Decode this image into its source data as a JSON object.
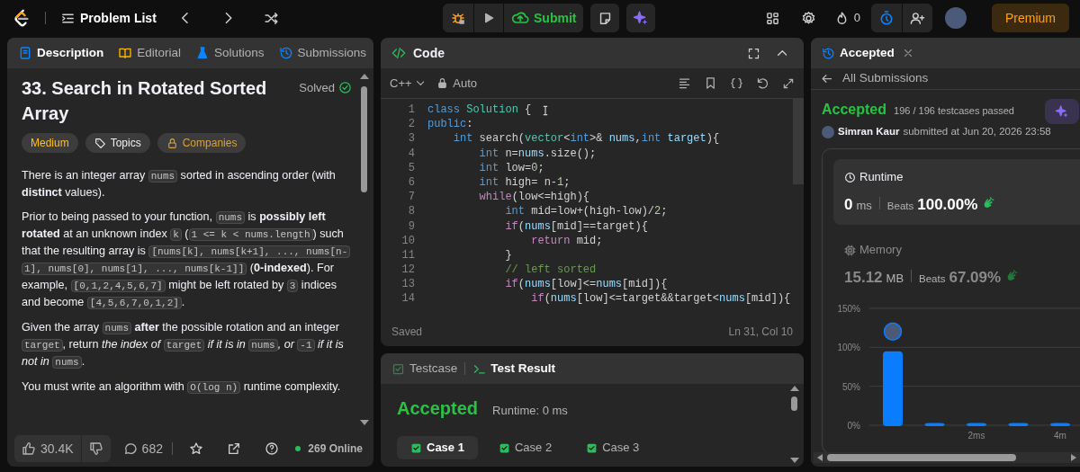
{
  "topbar": {
    "problem_list": "Problem List",
    "submit": "Submit",
    "streak": "0",
    "premium": "Premium"
  },
  "description_panel": {
    "tabs": [
      {
        "label": "Description",
        "kind": "description",
        "selected": true
      },
      {
        "label": "Editorial",
        "kind": "editorial",
        "selected": false
      },
      {
        "label": "Solutions",
        "kind": "solutions",
        "selected": false
      },
      {
        "label": "Submissions",
        "kind": "submissions",
        "selected": false
      }
    ],
    "title": "33. Search in Rotated Sorted Array",
    "status": "Solved",
    "tags": [
      {
        "label": "Medium",
        "kind": "difficulty"
      },
      {
        "label": "Topics",
        "kind": "topics"
      },
      {
        "label": "Companies",
        "kind": "companies"
      }
    ],
    "paragraphs": [
      [
        {
          "kind": "text",
          "text": "There is an integer array "
        },
        {
          "kind": "code",
          "text": "nums"
        },
        {
          "kind": "text",
          "text": " sorted in ascending order (with **distinct** values)."
        }
      ],
      [
        {
          "kind": "text",
          "text": "Prior to being passed to your function, "
        },
        {
          "kind": "code",
          "text": "nums"
        },
        {
          "kind": "text",
          "text": " is **possibly left rotated** at an unknown index "
        },
        {
          "kind": "code",
          "text": "k"
        },
        {
          "kind": "text",
          "text": " ("
        },
        {
          "kind": "code",
          "text": "1 <= k < nums.length"
        },
        {
          "kind": "text",
          "text": ") such that the resulting array is "
        },
        {
          "kind": "code",
          "text": "[nums[k], nums[k+1], ..., nums[n-1], nums[0], nums[1], ..., nums[k-1]]"
        },
        {
          "kind": "text",
          "text": " (**0-indexed**). For example, "
        },
        {
          "kind": "code",
          "text": "[0,1,2,4,5,6,7]"
        },
        {
          "kind": "text",
          "text": " might be left rotated by "
        },
        {
          "kind": "code",
          "text": "3"
        },
        {
          "kind": "text",
          "text": " indices and become "
        },
        {
          "kind": "code",
          "text": "[4,5,6,7,0,1,2]"
        },
        {
          "kind": "text",
          "text": "."
        }
      ],
      [
        {
          "kind": "text",
          "text": "Given the array "
        },
        {
          "kind": "code",
          "text": "nums"
        },
        {
          "kind": "text",
          "text": " **after** the possible rotation and an integer "
        },
        {
          "kind": "code",
          "text": "target"
        },
        {
          "kind": "text",
          "text": ", return *the index of* "
        },
        {
          "kind": "code",
          "text": "target"
        },
        {
          "kind": "text",
          "text": " *if it is in* "
        },
        {
          "kind": "code",
          "text": "nums"
        },
        {
          "kind": "text",
          "text": "*, or* "
        },
        {
          "kind": "code",
          "text": "-1"
        },
        {
          "kind": "text",
          "text": " *if it is not in* "
        },
        {
          "kind": "code",
          "text": "nums"
        },
        {
          "kind": "text",
          "text": "."
        }
      ],
      [
        {
          "kind": "text",
          "text": "You must write an algorithm with "
        },
        {
          "kind": "code",
          "text": "O(log n)"
        },
        {
          "kind": "text",
          "text": " runtime complexity."
        }
      ]
    ],
    "footer": {
      "likes": "30.4K",
      "comments": "682",
      "online": "269 Online"
    }
  },
  "code_panel": {
    "title": "Code",
    "language": "C++",
    "mode": "Auto",
    "lines": [
      {
        "number": "1",
        "tokens": [
          {
            "kind": "kw",
            "text": "class"
          },
          {
            "kind": "ty",
            "text": " Solution"
          },
          {
            "kind": "p",
            "text": " {"
          }
        ]
      },
      {
        "number": "2",
        "tokens": [
          {
            "kind": "kw",
            "text": "public"
          },
          {
            "kind": "p",
            "text": ":"
          }
        ]
      },
      {
        "number": "3",
        "tokens": [
          {
            "kind": "kw",
            "text": "    int"
          },
          {
            "kind": "p",
            "text": " search("
          },
          {
            "kind": "ty",
            "text": "vector"
          },
          {
            "kind": "p",
            "text": "<"
          },
          {
            "kind": "kw",
            "text": "int"
          },
          {
            "kind": "p",
            "text": ">& "
          },
          {
            "kind": "v",
            "text": "nums"
          },
          {
            "kind": "p",
            "text": ","
          },
          {
            "kind": "kw",
            "text": "int"
          },
          {
            "kind": "v",
            "text": " target"
          },
          {
            "kind": "p",
            "text": "){"
          }
        ]
      },
      {
        "number": "4",
        "tokens": [
          {
            "kind": "kw",
            "text": "        int"
          },
          {
            "kind": "p",
            "text": " n="
          },
          {
            "kind": "v",
            "text": "nums"
          },
          {
            "kind": "p",
            "text": ".size();"
          }
        ]
      },
      {
        "number": "5",
        "tokens": [
          {
            "kind": "kw",
            "text": "        int"
          },
          {
            "kind": "p",
            "text": " low="
          },
          {
            "kind": "n",
            "text": "0"
          },
          {
            "kind": "p",
            "text": ";"
          }
        ]
      },
      {
        "number": "6",
        "tokens": [
          {
            "kind": "kw",
            "text": "        int"
          },
          {
            "kind": "p",
            "text": " high= n-"
          },
          {
            "kind": "n",
            "text": "1"
          },
          {
            "kind": "p",
            "text": ";"
          }
        ]
      },
      {
        "number": "7",
        "tokens": [
          {
            "kind": "c",
            "text": "        while"
          },
          {
            "kind": "p",
            "text": "(low<=high){"
          }
        ]
      },
      {
        "number": "8",
        "tokens": [
          {
            "kind": "kw",
            "text": "            int"
          },
          {
            "kind": "p",
            "text": " mid=low+(high-low)/"
          },
          {
            "kind": "n",
            "text": "2"
          },
          {
            "kind": "p",
            "text": ";"
          }
        ]
      },
      {
        "number": "9",
        "tokens": [
          {
            "kind": "c",
            "text": "            if"
          },
          {
            "kind": "p",
            "text": "("
          },
          {
            "kind": "v",
            "text": "nums"
          },
          {
            "kind": "p",
            "text": "[mid]==target){"
          }
        ]
      },
      {
        "number": "10",
        "tokens": [
          {
            "kind": "c",
            "text": "                return"
          },
          {
            "kind": "p",
            "text": " mid;"
          }
        ]
      },
      {
        "number": "11",
        "tokens": [
          {
            "kind": "p",
            "text": "            }"
          }
        ]
      },
      {
        "number": "12",
        "tokens": [
          {
            "kind": "m",
            "text": "            // left sorted"
          }
        ]
      },
      {
        "number": "13",
        "tokens": [
          {
            "kind": "c",
            "text": "            if"
          },
          {
            "kind": "p",
            "text": "("
          },
          {
            "kind": "v",
            "text": "nums"
          },
          {
            "kind": "p",
            "text": "[low]<="
          },
          {
            "kind": "v",
            "text": "nums"
          },
          {
            "kind": "p",
            "text": "[mid]){"
          }
        ]
      },
      {
        "number": "14",
        "tokens": [
          {
            "kind": "c",
            "text": "                if"
          },
          {
            "kind": "p",
            "text": "("
          },
          {
            "kind": "v",
            "text": "nums"
          },
          {
            "kind": "p",
            "text": "[low]<=target&&target<"
          },
          {
            "kind": "v",
            "text": "nums"
          },
          {
            "kind": "p",
            "text": "[mid]){"
          }
        ]
      }
    ],
    "save_status": "Saved",
    "cursor_position": "Ln 31, Col 10"
  },
  "test_panel": {
    "tabs": [
      {
        "label": "Testcase",
        "kind": "testcase",
        "selected": false
      },
      {
        "label": "Test Result",
        "kind": "result",
        "selected": true
      }
    ],
    "result": "Accepted",
    "runtime": "Runtime: 0 ms",
    "cases": [
      {
        "label": "Case 1",
        "selected": true
      },
      {
        "label": "Case 2",
        "selected": false
      },
      {
        "label": "Case 3",
        "selected": false
      }
    ]
  },
  "submission_panel": {
    "tab": "Accepted",
    "back": "All Submissions",
    "status": "Accepted",
    "passed": "196 / 196 testcases passed",
    "author": "Simran Kaur",
    "submitted": "submitted at Jun 20, 2026 23:58",
    "stats": [
      {
        "kind": "runtime",
        "label": "Runtime",
        "value": "0",
        "unit": "ms",
        "beats_label": "Beats",
        "beats": "100.00%",
        "selected": true
      },
      {
        "kind": "memory",
        "label": "Memory",
        "value": "15.12",
        "unit": "MB",
        "beats_label": "Beats",
        "beats": "67.09%",
        "selected": false
      }
    ],
    "chart_data": {
      "type": "bar",
      "categories": [
        null,
        null,
        "2ms",
        null,
        "4m"
      ],
      "values": [
        95,
        3,
        3,
        3,
        3
      ],
      "ylim": [
        0,
        150
      ],
      "yticks": [
        {
          "value": 0,
          "label": "0%"
        },
        {
          "value": 50,
          "label": "50%"
        },
        {
          "value": 100,
          "label": "100%"
        },
        {
          "value": 150,
          "label": "150%"
        }
      ]
    }
  }
}
